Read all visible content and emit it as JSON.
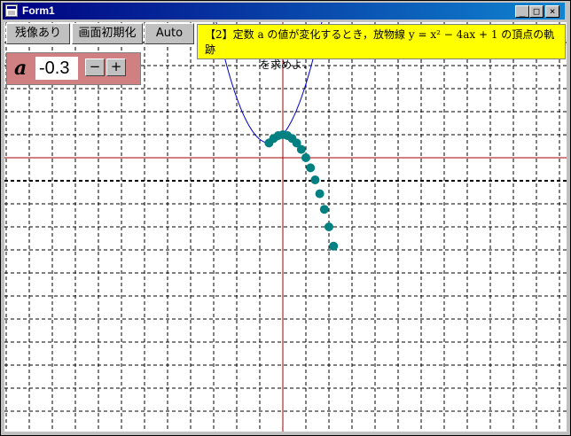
{
  "window": {
    "title": "Form1",
    "minimize": "_",
    "maximize": "□",
    "close": "×"
  },
  "toolbar": {
    "afterimage_label": "残像あり",
    "reset_label": "画面初期化",
    "auto_label": "Auto"
  },
  "param": {
    "name": "a",
    "value": "-0.3",
    "minus_label": "−",
    "plus_label": "+"
  },
  "problem": {
    "line1": "【2】定数 a の値が変化するとき，放物線 y = x² − 4ax + 1 の頂点の軌跡",
    "line2": "を求めよ．"
  },
  "colors": {
    "parabola": "#0000cc",
    "vertex_dots": "#008080",
    "axes": "#a00000",
    "panel": "#d08080",
    "note": "#ffff00"
  },
  "plot": {
    "current_a": -0.3,
    "vertex_history_a": [
      -0.3,
      -0.2,
      -0.1,
      0.0,
      0.1,
      0.2,
      0.3,
      0.4,
      0.5,
      0.6,
      0.7,
      0.8,
      0.9,
      1.0,
      1.1
    ]
  }
}
